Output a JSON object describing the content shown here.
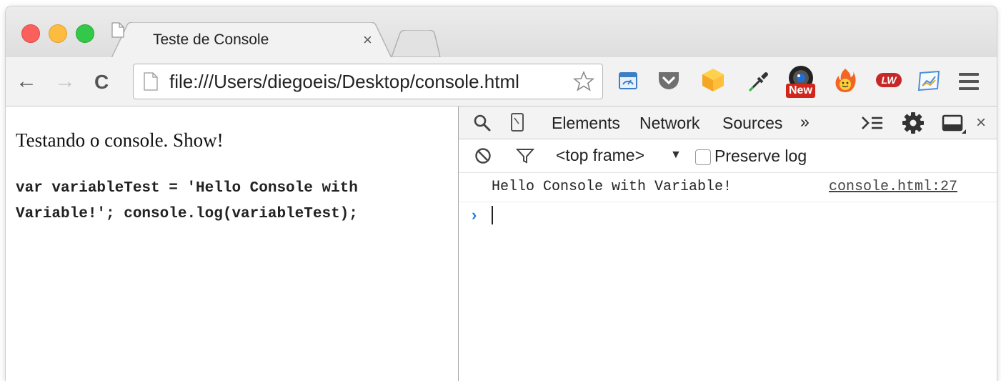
{
  "tab": {
    "title": "Teste de Console",
    "close": "×"
  },
  "toolbar": {
    "back": "←",
    "forward": "→",
    "reload": "C",
    "url": "file:///Users/diegoeis/Desktop/console.html",
    "extensions": [
      {
        "name": "analytics-extension-icon"
      },
      {
        "name": "pocket-icon"
      },
      {
        "name": "box-extension-icon"
      },
      {
        "name": "eyedropper-icon"
      },
      {
        "name": "new-badge-extension-icon",
        "badge": "New"
      },
      {
        "name": "hola-flame-icon"
      },
      {
        "name": "lw-extension-icon",
        "label": "LW"
      },
      {
        "name": "chart-extension-icon"
      }
    ]
  },
  "page": {
    "text": "Testando o console. Show!",
    "code": "var variableTest = 'Hello Console with Variable!'; console.log(variableTest);"
  },
  "devtools": {
    "tabs": [
      "Elements",
      "Network",
      "Sources"
    ],
    "more": "»",
    "frame": "<top frame>",
    "frame_arrow": "▼",
    "preserve_log": "Preserve log",
    "close": "×",
    "console": {
      "message": "Hello Console with Variable!",
      "source": "console.html:27",
      "prompt": "›"
    }
  },
  "colors": {
    "close_red": "#fc605c",
    "minimize_yellow": "#fdbc40",
    "zoom_green": "#34c84a",
    "prompt_blue": "#2c7be5"
  }
}
